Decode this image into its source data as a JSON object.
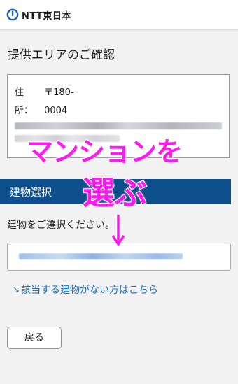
{
  "header": {
    "logo_text": "NTT東日本",
    "logo_icon": "ntt-logo-icon"
  },
  "page_title": "提供エリアのご確認",
  "address": {
    "label_line1": "住",
    "postal_line1": "〒180-",
    "label_line2": "所：",
    "postal_line2": "0004"
  },
  "section": {
    "title": "建物選択"
  },
  "building_prompt": "建物をご選択ください。",
  "not_found_link": "該当する建物がない方はこちら",
  "back_button": "戻る",
  "annotation": {
    "line1": "マンションを",
    "line2": "選ぶ",
    "color": "#ff19f0",
    "arrow_icon": "down-arrow-icon"
  },
  "colors": {
    "section_bar": "#0c4f8b",
    "link": "#1c6fb8",
    "background": "#f2f2f2"
  }
}
